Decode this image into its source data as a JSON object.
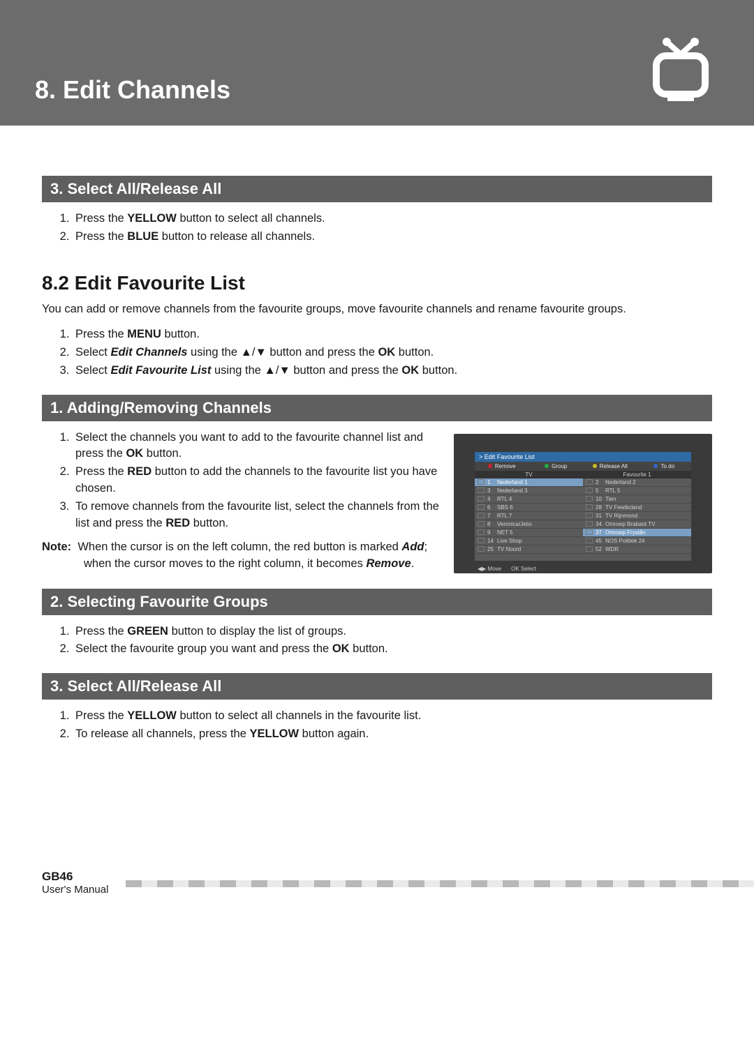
{
  "header": {
    "title": "8. Edit Channels"
  },
  "sec3a": {
    "heading": "3. Select All/Release All",
    "items": [
      {
        "pre": "Press the ",
        "bold": "YELLOW",
        "post": " button to select all channels."
      },
      {
        "pre": "Press the ",
        "bold": "BLUE",
        "post": " button to release all channels."
      }
    ]
  },
  "sec82": {
    "heading": "8.2 Edit Favourite List",
    "intro": "You can add or remove channels from the favourite groups, move favourite channels and rename favourite groups.",
    "steps": [
      {
        "pre": "Press the ",
        "bold": "MENU",
        "post": " button."
      },
      {
        "pre": "Select ",
        "ital": "Edit Channels",
        "mid": " using the ▲/▼ button and press the ",
        "bold": "OK",
        "post": " button."
      },
      {
        "pre": "Select ",
        "ital": "Edit Favourite List",
        "mid": " using the ▲/▼ button and press the ",
        "bold": "OK",
        "post": " button."
      }
    ]
  },
  "sub1": {
    "heading": "1. Adding/Removing Channels",
    "steps": [
      {
        "text": "Select the channels you want to add to the favourite channel list and press the ",
        "bold": "OK",
        "post": " button."
      },
      {
        "text": "Press the ",
        "bold": "RED",
        "post": " button to add the channels to the favourite list you have chosen."
      },
      {
        "text": "To remove channels from the favourite list, select the channels from the list and press the ",
        "bold": "RED",
        "post": " button."
      }
    ],
    "note_label": "Note:",
    "note": "When the cursor is on the left column, the red button is marked ",
    "note_ital1": "Add",
    "note_mid": "; when the cursor moves to the right column, it becomes ",
    "note_ital2": "Remove",
    "note_end": "."
  },
  "sub2": {
    "heading": "2. Selecting Favourite Groups",
    "steps": [
      {
        "pre": "Press the ",
        "bold": "GREEN",
        "post": " button to display the list of groups."
      },
      {
        "pre": "Select the favourite group you want and press the ",
        "bold": "OK",
        "post": " button."
      }
    ]
  },
  "sub3": {
    "heading": "3. Select All/Release All",
    "steps": [
      {
        "pre": "Press the ",
        "bold": "YELLOW",
        "post": " button to select all channels in the favourite list."
      },
      {
        "pre": "To release all channels, press the ",
        "bold": "YELLOW",
        "post": " button again."
      }
    ]
  },
  "screenshot": {
    "title": "> Edit Favourite List",
    "tabs": [
      "Remove",
      "Group",
      "Release All",
      "To do"
    ],
    "left_header": "TV",
    "right_header": "Favourite 1",
    "left": [
      {
        "n": "1",
        "t": "Nederland 1",
        "sel": true
      },
      {
        "n": "3",
        "t": "Nederland 3"
      },
      {
        "n": "4",
        "t": "RTL 4"
      },
      {
        "n": "6",
        "t": "SBS 6"
      },
      {
        "n": "7",
        "t": "RTL 7"
      },
      {
        "n": "8",
        "t": "Veronica/Jetix"
      },
      {
        "n": "9",
        "t": "NET 5"
      },
      {
        "n": "14",
        "t": "Live Shop"
      },
      {
        "n": "25",
        "t": "TV Noord"
      }
    ],
    "right": [
      {
        "n": "2",
        "t": "Nederland 2"
      },
      {
        "n": "5",
        "t": "RTL 5"
      },
      {
        "n": "10",
        "t": "Tien"
      },
      {
        "n": "28",
        "t": "TV Fewikcland"
      },
      {
        "n": "31",
        "t": "TV Rijnmond"
      },
      {
        "n": "34",
        "t": "Omroep Brabant TV"
      },
      {
        "n": "37",
        "t": "Omroep Fryslân",
        "sel": true
      },
      {
        "n": "45",
        "t": "NOS Politiek 24"
      },
      {
        "n": "52",
        "t": "WDR"
      }
    ],
    "foot": [
      "Move",
      "Select"
    ]
  },
  "footer": {
    "page": "GB46",
    "doc": "User's Manual"
  }
}
